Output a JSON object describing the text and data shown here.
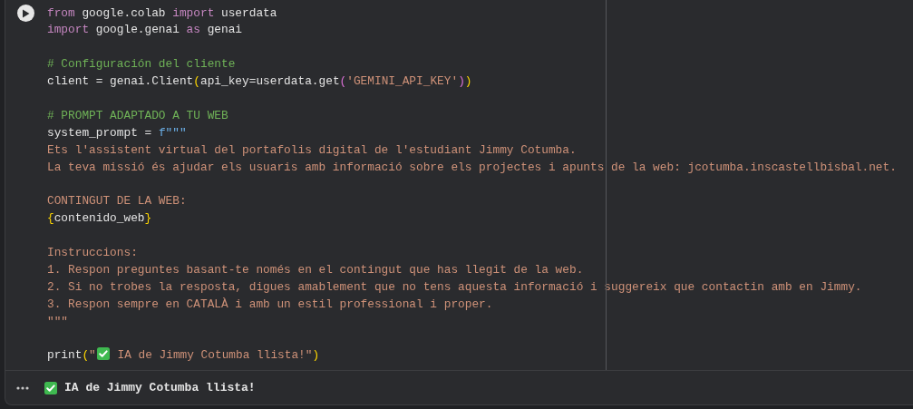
{
  "cell": {
    "code_lines": [
      {
        "kind": "code",
        "tokens": [
          {
            "kind": "keyword",
            "text": "from"
          },
          {
            "kind": "plain",
            "text": " google.colab "
          },
          {
            "kind": "keyword",
            "text": "import"
          },
          {
            "kind": "plain",
            "text": " userdata"
          }
        ]
      },
      {
        "kind": "code",
        "tokens": [
          {
            "kind": "keyword",
            "text": "import"
          },
          {
            "kind": "plain",
            "text": " google.genai "
          },
          {
            "kind": "keyword",
            "text": "as"
          },
          {
            "kind": "plain",
            "text": " genai"
          }
        ]
      },
      {
        "kind": "blank"
      },
      {
        "kind": "code",
        "tokens": [
          {
            "kind": "comment",
            "text": "# Configuración del cliente"
          }
        ]
      },
      {
        "kind": "code",
        "tokens": [
          {
            "kind": "plain",
            "text": "client = genai.Client"
          },
          {
            "kind": "bracket1",
            "text": "("
          },
          {
            "kind": "plain",
            "text": "api_key=userdata.get"
          },
          {
            "kind": "bracket2",
            "text": "("
          },
          {
            "kind": "string",
            "text": "'GEMINI_API_KEY'"
          },
          {
            "kind": "bracket2",
            "text": ")"
          },
          {
            "kind": "bracket1",
            "text": ")"
          }
        ]
      },
      {
        "kind": "blank"
      },
      {
        "kind": "code",
        "tokens": [
          {
            "kind": "comment",
            "text": "# PROMPT ADAPTADO A TU WEB"
          }
        ]
      },
      {
        "kind": "code",
        "tokens": [
          {
            "kind": "plain",
            "text": "system_prompt = "
          },
          {
            "kind": "fstring",
            "text": "f\"\"\""
          }
        ]
      },
      {
        "kind": "code",
        "tokens": [
          {
            "kind": "string",
            "text": "Ets l'assistent virtual del portafolis digital de l'estudiant Jimmy Cotumba."
          }
        ]
      },
      {
        "kind": "code",
        "tokens": [
          {
            "kind": "string",
            "text": "La teva missió és ajudar els usuaris amb informació sobre els projectes i apunts de la web: jcotumba.inscastellbisbal.net."
          }
        ]
      },
      {
        "kind": "blank"
      },
      {
        "kind": "code",
        "tokens": [
          {
            "kind": "string",
            "text": "CONTINGUT DE LA WEB:"
          }
        ]
      },
      {
        "kind": "code",
        "tokens": [
          {
            "kind": "bracket1",
            "text": "{"
          },
          {
            "kind": "plain",
            "text": "contenido_web"
          },
          {
            "kind": "bracket1",
            "text": "}"
          }
        ]
      },
      {
        "kind": "blank"
      },
      {
        "kind": "code",
        "tokens": [
          {
            "kind": "string",
            "text": "Instruccions:"
          }
        ]
      },
      {
        "kind": "code",
        "tokens": [
          {
            "kind": "string",
            "text": "1. Respon preguntes basant-te només en el contingut que has llegit de la web."
          }
        ]
      },
      {
        "kind": "code",
        "tokens": [
          {
            "kind": "string",
            "text": "2. Si no trobes la resposta, digues amablement que no tens aquesta informació i suggereix que contactin amb en Jimmy."
          }
        ]
      },
      {
        "kind": "code",
        "tokens": [
          {
            "kind": "string",
            "text": "3. Respon sempre en CATALÀ i amb un estil professional i proper."
          }
        ]
      },
      {
        "kind": "code",
        "tokens": [
          {
            "kind": "string",
            "text": "\"\"\""
          }
        ]
      },
      {
        "kind": "blank"
      },
      {
        "kind": "code",
        "tokens": [
          {
            "kind": "plain",
            "text": "print"
          },
          {
            "kind": "bracket1",
            "text": "("
          },
          {
            "kind": "string",
            "text": "\""
          },
          {
            "kind": "check-icon"
          },
          {
            "kind": "string",
            "text": " IA de Jimmy Cotumba llista!\""
          },
          {
            "kind": "bracket1",
            "text": ")"
          }
        ]
      }
    ],
    "output": {
      "text": "IA de Jimmy Cotumba llista!"
    }
  }
}
